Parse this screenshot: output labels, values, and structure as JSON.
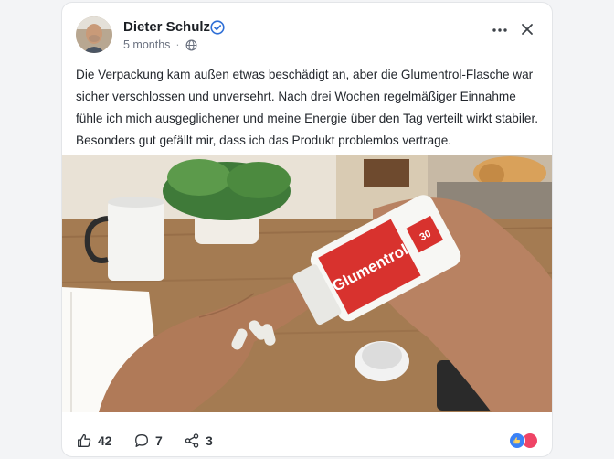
{
  "post": {
    "author": "Dieter Schulz",
    "time": "5 months",
    "visibility_icon": "globe-icon",
    "verified_icon": "verified-badge-icon",
    "text": "Die Verpackung kam außen etwas beschädigt an, aber die Glumentrol-Flasche war sicher verschlossen und unversehrt. Nach drei Wochen regelmäßiger Einnahme fühle ich mich ausgeglichener und meine Energie über den Tag verteilt wirkt stabiler. Besonders gut gefällt mir, dass ich das Produkt problemlos vertrage.",
    "photo": {
      "bottle_brand": "Glumentrol",
      "bottle_count": "30"
    }
  },
  "actions": {
    "likes": "42",
    "comments": "7",
    "shares": "3"
  },
  "colors": {
    "accent": "#2f6fd6",
    "bottle_red": "#d8322e",
    "reaction_like": "#3b82f6",
    "reaction_love": "#ef4466"
  }
}
